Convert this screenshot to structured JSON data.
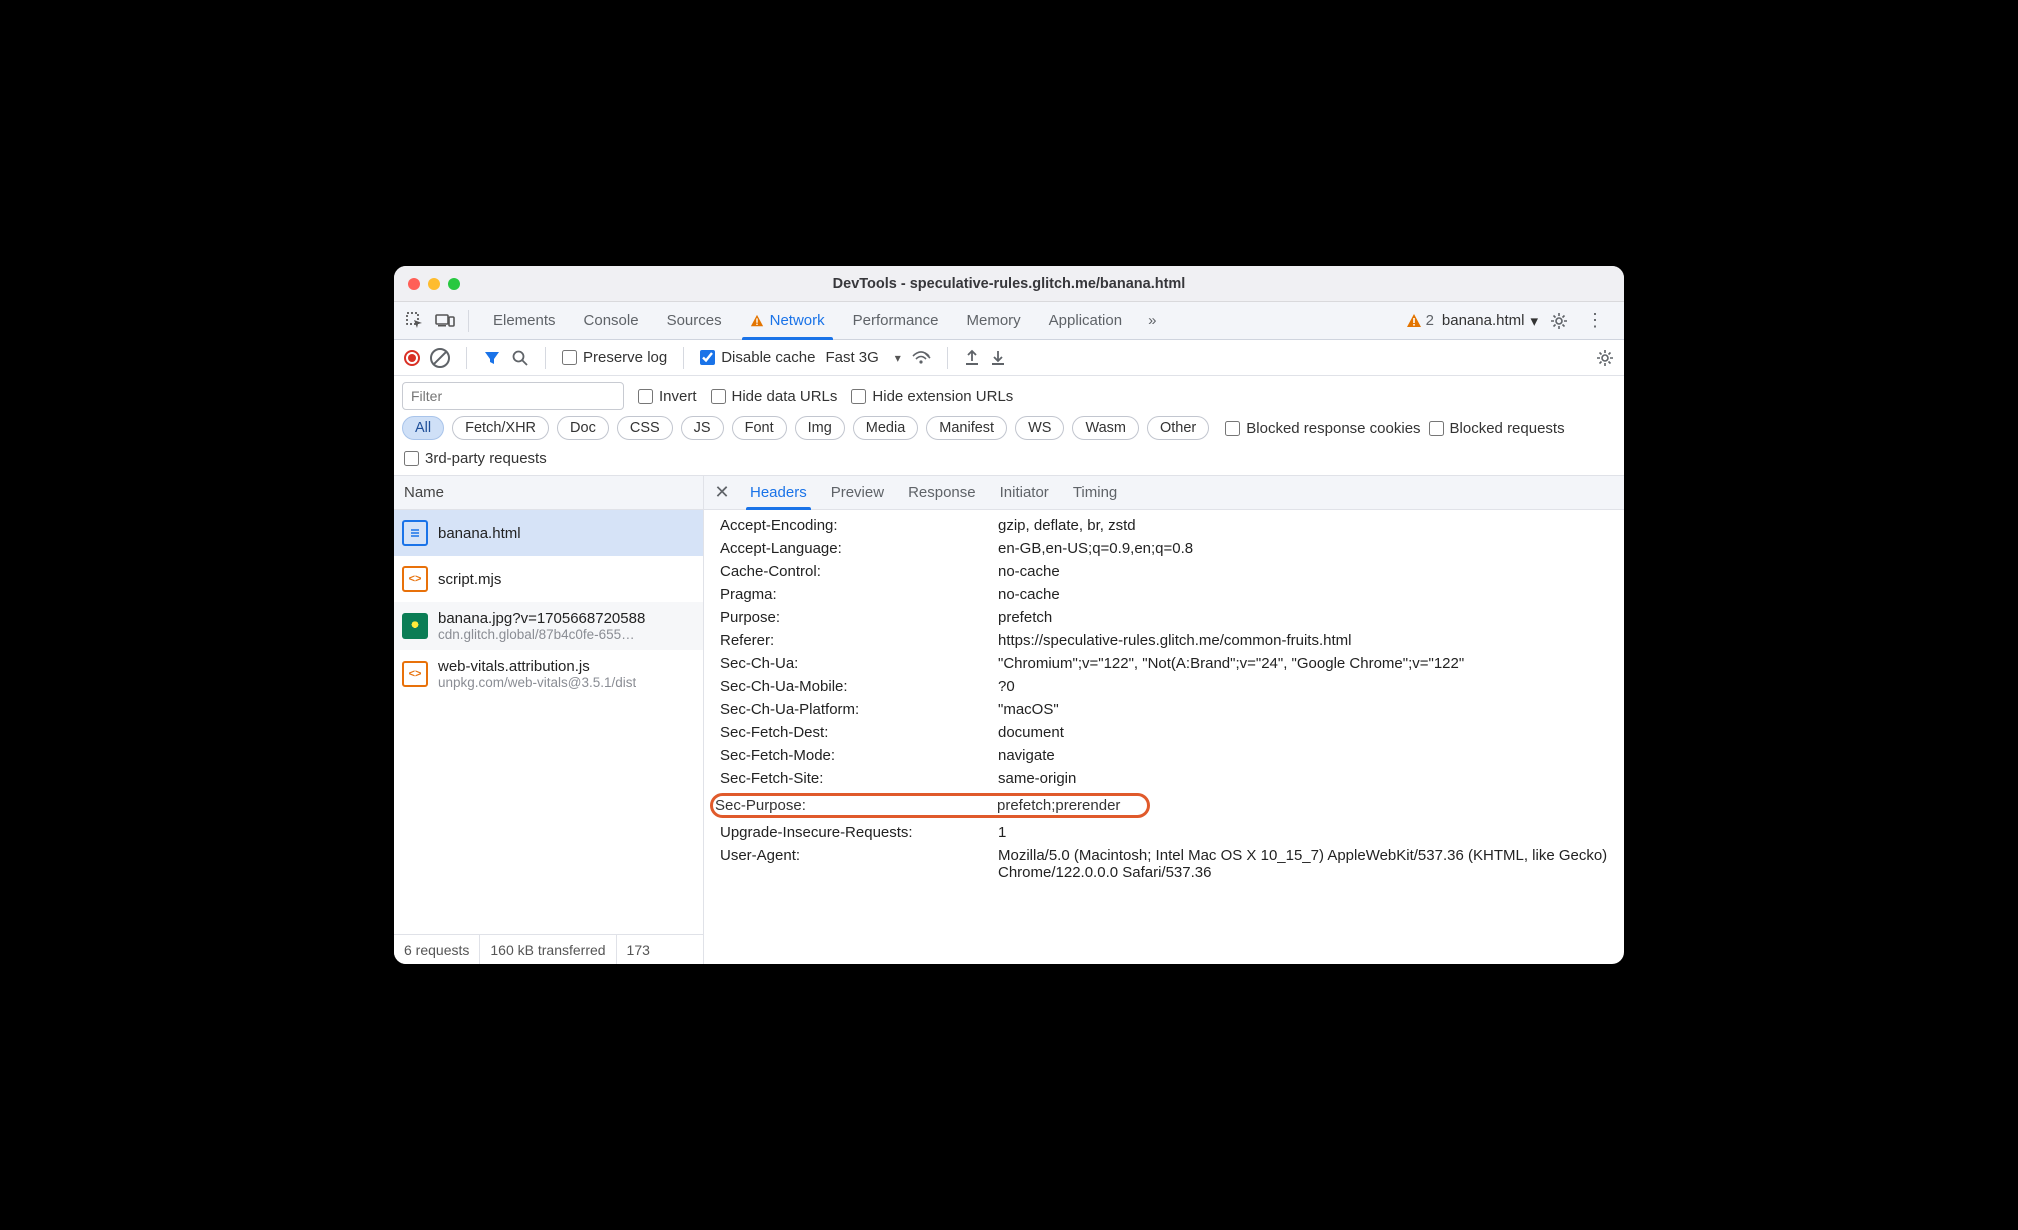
{
  "window": {
    "title": "DevTools - speculative-rules.glitch.me/banana.html"
  },
  "mainTabs": {
    "items": [
      "Elements",
      "Console",
      "Sources",
      "Network",
      "Performance",
      "Memory",
      "Application"
    ],
    "activeIndex": 3,
    "warningOnIndex": 3,
    "overflow": "»"
  },
  "warnings": {
    "count": "2"
  },
  "frameSelector": {
    "label": "banana.html"
  },
  "toolbar": {
    "preserveLog": {
      "label": "Preserve log",
      "checked": false
    },
    "disableCache": {
      "label": "Disable cache",
      "checked": true
    },
    "throttling": "Fast 3G"
  },
  "filters": {
    "placeholder": "Filter",
    "invert": {
      "label": "Invert",
      "checked": false
    },
    "hideDataUrls": {
      "label": "Hide data URLs",
      "checked": false
    },
    "hideExtensionUrls": {
      "label": "Hide extension URLs",
      "checked": false
    },
    "types": [
      "All",
      "Fetch/XHR",
      "Doc",
      "CSS",
      "JS",
      "Font",
      "Img",
      "Media",
      "Manifest",
      "WS",
      "Wasm",
      "Other"
    ],
    "activeTypeIndex": 0,
    "blockedResponseCookies": {
      "label": "Blocked response cookies",
      "checked": false
    },
    "blockedRequests": {
      "label": "Blocked requests",
      "checked": false
    },
    "thirdParty": {
      "label": "3rd-party requests",
      "checked": false
    }
  },
  "requestList": {
    "header": "Name",
    "items": [
      {
        "name": "banana.html",
        "sub": "",
        "icon": "doc",
        "selected": true
      },
      {
        "name": "script.mjs",
        "sub": "",
        "icon": "js"
      },
      {
        "name": "banana.jpg?v=1705668720588",
        "sub": "cdn.glitch.global/87b4c0fe-655…",
        "icon": "img"
      },
      {
        "name": "web-vitals.attribution.js",
        "sub": "unpkg.com/web-vitals@3.5.1/dist",
        "icon": "js"
      }
    ]
  },
  "statusbar": {
    "requests": "6 requests",
    "transferred": "160 kB transferred",
    "resources": "173"
  },
  "detailTabs": {
    "items": [
      "Headers",
      "Preview",
      "Response",
      "Initiator",
      "Timing"
    ],
    "activeIndex": 0
  },
  "headers": [
    {
      "k": "Accept-Encoding:",
      "v": "gzip, deflate, br, zstd"
    },
    {
      "k": "Accept-Language:",
      "v": "en-GB,en-US;q=0.9,en;q=0.8"
    },
    {
      "k": "Cache-Control:",
      "v": "no-cache"
    },
    {
      "k": "Pragma:",
      "v": "no-cache"
    },
    {
      "k": "Purpose:",
      "v": "prefetch"
    },
    {
      "k": "Referer:",
      "v": "https://speculative-rules.glitch.me/common-fruits.html"
    },
    {
      "k": "Sec-Ch-Ua:",
      "v": "\"Chromium\";v=\"122\", \"Not(A:Brand\";v=\"24\", \"Google Chrome\";v=\"122\""
    },
    {
      "k": "Sec-Ch-Ua-Mobile:",
      "v": "?0"
    },
    {
      "k": "Sec-Ch-Ua-Platform:",
      "v": "\"macOS\""
    },
    {
      "k": "Sec-Fetch-Dest:",
      "v": "document"
    },
    {
      "k": "Sec-Fetch-Mode:",
      "v": "navigate"
    },
    {
      "k": "Sec-Fetch-Site:",
      "v": "same-origin"
    },
    {
      "k": "Sec-Purpose:",
      "v": "prefetch;prerender",
      "highlighted": true
    },
    {
      "k": "Upgrade-Insecure-Requests:",
      "v": "1"
    },
    {
      "k": "User-Agent:",
      "v": "Mozilla/5.0 (Macintosh; Intel Mac OS X 10_15_7) AppleWebKit/537.36 (KHTML, like Gecko) Chrome/122.0.0.0 Safari/537.36"
    }
  ]
}
